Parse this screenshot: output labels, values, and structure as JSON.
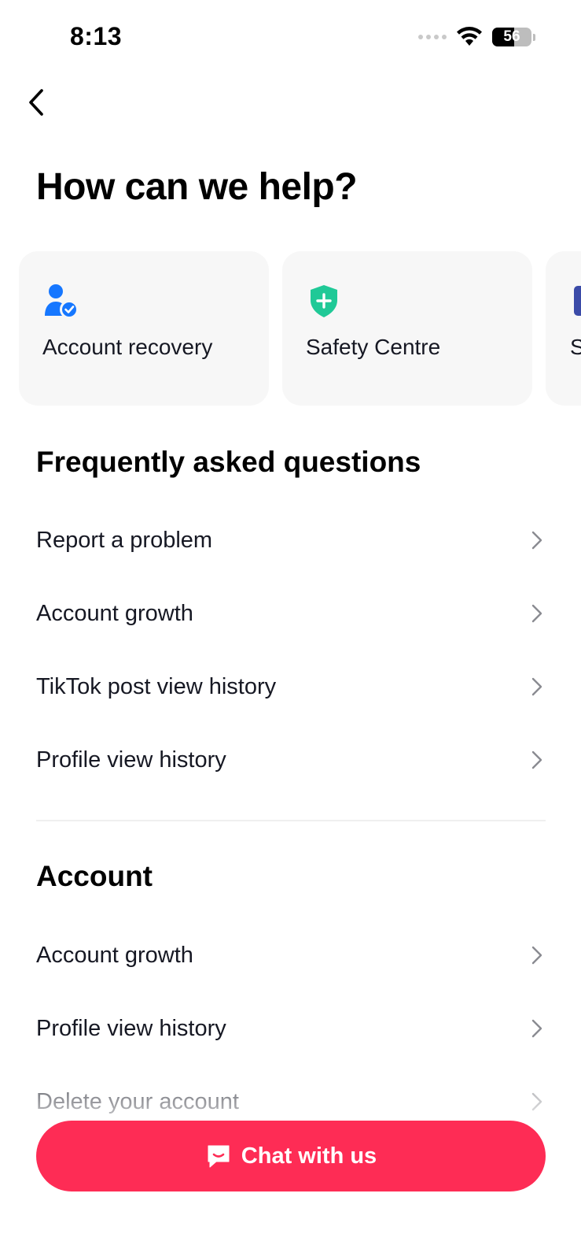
{
  "status_bar": {
    "time": "8:13",
    "battery": "56",
    "battery_level": 0.56
  },
  "title": "How can we help?",
  "quick_cards": [
    {
      "label": "Account recovery",
      "icon": "user-check-icon",
      "color": "#1677ff"
    },
    {
      "label": "Safety Centre",
      "icon": "shield-plus-icon",
      "color": "#20c997"
    },
    {
      "label": "S",
      "icon": "partial-card-icon",
      "color": "#3b4ba8"
    }
  ],
  "faq": {
    "title": "Frequently asked questions",
    "items": [
      "Report a problem",
      "Account growth",
      "TikTok post view history",
      "Profile view history"
    ]
  },
  "account": {
    "title": "Account",
    "items": [
      "Account growth",
      "Profile view history",
      "Delete your account"
    ]
  },
  "chat_button": {
    "label": "Chat with us",
    "icon": "chat-bubble-icon",
    "color": "#fe2c55"
  }
}
